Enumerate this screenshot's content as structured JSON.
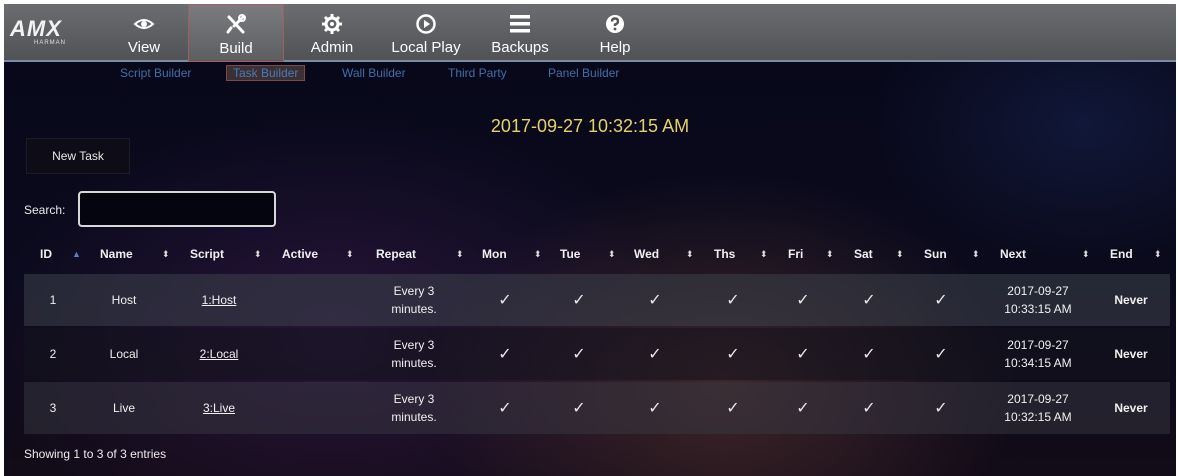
{
  "logo": {
    "brand": "AMX",
    "sub": "HARMAN"
  },
  "nav": {
    "items": [
      {
        "label": "View",
        "icon": "eye-icon"
      },
      {
        "label": "Build",
        "icon": "tools-icon"
      },
      {
        "label": "Admin",
        "icon": "gear-icon"
      },
      {
        "label": "Local Play",
        "icon": "play-circle-icon"
      },
      {
        "label": "Backups",
        "icon": "menu-icon"
      },
      {
        "label": "Help",
        "icon": "help-icon"
      }
    ],
    "active": "Build"
  },
  "subnav": {
    "items": [
      "Script Builder",
      "Task Builder",
      "Wall Builder",
      "Third Party",
      "Panel Builder"
    ],
    "active": "Task Builder"
  },
  "clock": "2017-09-27 10:32:15 AM",
  "new_task_label": "New Task",
  "search": {
    "label": "Search:",
    "value": ""
  },
  "table": {
    "columns": [
      "ID",
      "Name",
      "Script",
      "Active",
      "Repeat",
      "Mon",
      "Tue",
      "Wed",
      "Ths",
      "Fri",
      "Sat",
      "Sun",
      "Next",
      "End"
    ],
    "rows": [
      {
        "id": "1",
        "name": "Host",
        "script": "1:Host",
        "active": "",
        "repeat_1": "Every 3",
        "repeat_2": "minutes.",
        "mon": "✓",
        "tue": "✓",
        "wed": "✓",
        "ths": "✓",
        "fri": "✓",
        "sat": "✓",
        "sun": "✓",
        "next_1": "2017-09-27",
        "next_2": "10:33:15 AM",
        "end": "Never"
      },
      {
        "id": "2",
        "name": "Local",
        "script": "2:Local",
        "active": "",
        "repeat_1": "Every 3",
        "repeat_2": "minutes.",
        "mon": "✓",
        "tue": "✓",
        "wed": "✓",
        "ths": "✓",
        "fri": "✓",
        "sat": "✓",
        "sun": "✓",
        "next_1": "2017-09-27",
        "next_2": "10:34:15 AM",
        "end": "Never"
      },
      {
        "id": "3",
        "name": "Live",
        "script": "3:Live",
        "active": "",
        "repeat_1": "Every 3",
        "repeat_2": "minutes.",
        "mon": "✓",
        "tue": "✓",
        "wed": "✓",
        "ths": "✓",
        "fri": "✓",
        "sat": "✓",
        "sun": "✓",
        "next_1": "2017-09-27",
        "next_2": "10:32:15 AM",
        "end": "Never"
      }
    ]
  },
  "footer": "Showing 1 to 3 of 3 entries",
  "colors": {
    "clock": "#e6d26a",
    "subnav_link": "#3f6fa8",
    "nav_bg": "#5a5c60",
    "sort_active": "#5a7fc0"
  }
}
